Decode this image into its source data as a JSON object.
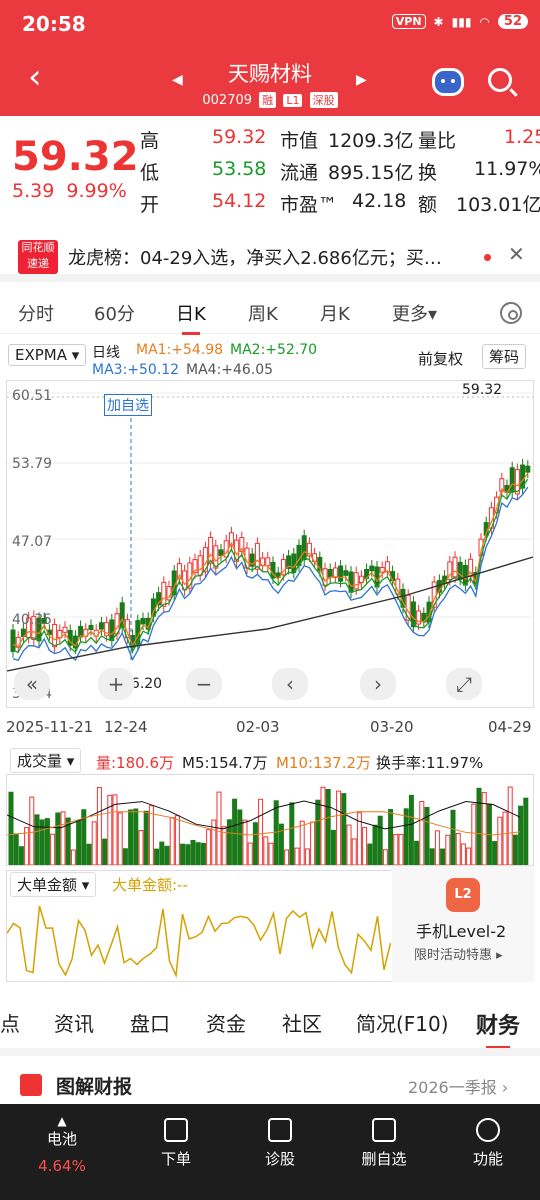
{
  "status": {
    "time": "20:58",
    "vpn": "VPN",
    "battery": "52"
  },
  "header": {
    "title": "天赐材料",
    "code": "002709",
    "tags": [
      "融",
      "L1",
      "深股"
    ]
  },
  "quote": {
    "price": "59.32",
    "change": "5.39",
    "pct": "9.99%",
    "labels": {
      "high": "高",
      "low": "低",
      "open": "开",
      "mcap": "市值",
      "float": "流通",
      "pe": "市盈™",
      "vol_ratio": "量比",
      "turnover": "换",
      "amount": "额"
    },
    "high": "59.32",
    "low": "53.58",
    "open": "54.12",
    "mcap": "1209.3亿",
    "float": "895.15亿",
    "pe": "42.18",
    "vol_ratio": "1.25",
    "turnover": "11.97%",
    "amount": "103.01亿"
  },
  "news": {
    "logo": "同花顺 速递",
    "text": "龙虎榜：04-29入选，净买入2.686亿元；买…"
  },
  "tabs": [
    "分时",
    "60分",
    "日K",
    "周K",
    "月K",
    "更多▾"
  ],
  "ma": {
    "indicator": "EXPMA ▾",
    "period": "日线",
    "ma1": "MA1:+54.98",
    "ma2": "MA2:+52.70",
    "ma3": "MA3:+50.12",
    "ma4": "MA4:+46.05",
    "adj": "前复权",
    "chip": "筹码"
  },
  "chart_axis": {
    "top": "60.51",
    "mid1": "53.79",
    "mid2": "47.07",
    "mid3": "40.35",
    "bottom": "33.64",
    "last": "59.32",
    "low_mark": "36.20",
    "add_watch": "加自选"
  },
  "dates": [
    "2025-11-21",
    "12-24",
    "02-03",
    "03-20",
    "04-29"
  ],
  "volume": {
    "label": "成交量 ▾",
    "vol": "量:180.6万",
    "m5": "M5:154.7万",
    "m10": "M10:137.2万",
    "turnover": "换手率:11.97%"
  },
  "bigorder": {
    "label": "大单金额 ▾",
    "value": "大单金额:--"
  },
  "promo": {
    "icon": "L2",
    "title": "手机Level-2",
    "sub": "限时活动特惠 ▸"
  },
  "ftabs": [
    "点",
    "资讯",
    "盘口",
    "资金",
    "社区",
    "简况(F10)",
    "财务"
  ],
  "report": {
    "title": "图解财报",
    "period": "2026一季报 ›"
  },
  "bottom": {
    "battery": "电池",
    "battery_pct": "4.64%",
    "items": [
      "下单",
      "诊股",
      "删自选",
      "功能"
    ]
  }
}
